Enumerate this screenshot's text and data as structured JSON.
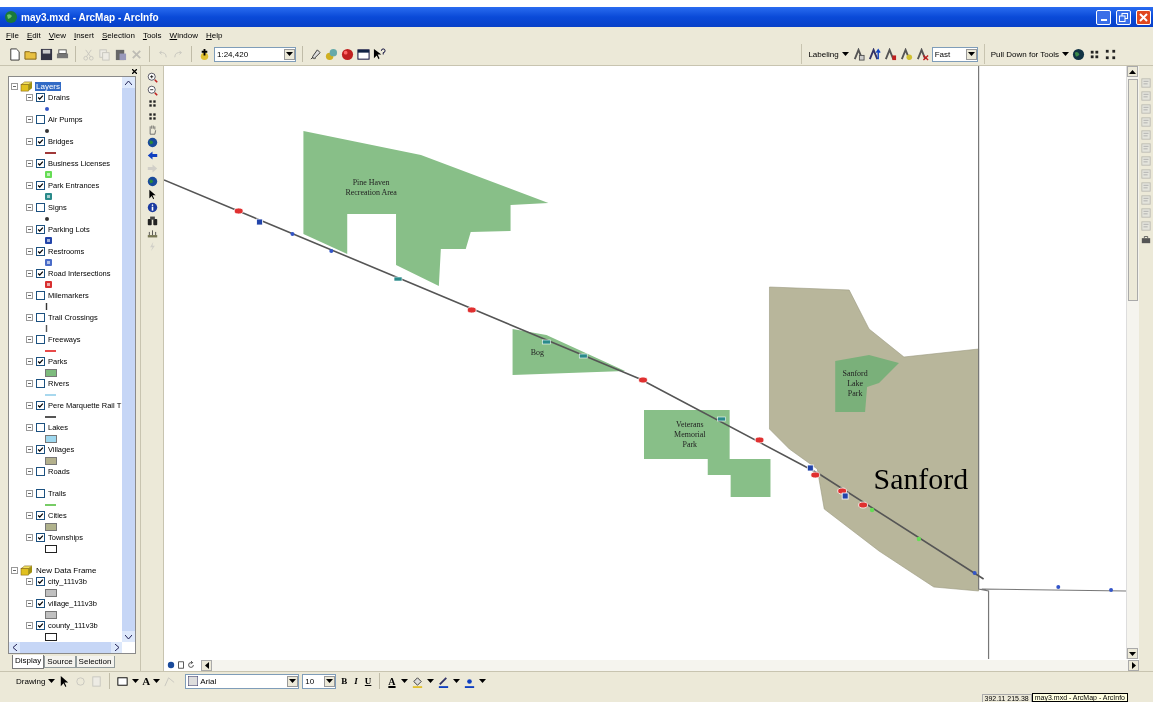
{
  "window": {
    "title": "may3.mxd - ArcMap - ArcInfo"
  },
  "menu": [
    "File",
    "Edit",
    "View",
    "Insert",
    "Selection",
    "Tools",
    "Window",
    "Help"
  ],
  "standard_toolbar": {
    "scale": "1:24,420"
  },
  "labeling_toolbar": {
    "label": "Labeling",
    "quality": "Fast"
  },
  "tools_toolbar": {
    "label": "Pull Down for Tools"
  },
  "toc": {
    "frames": [
      {
        "name": "Layers",
        "selected": true,
        "layers": [
          {
            "name": "Drains",
            "checked": true,
            "kind": "dot",
            "color": "#3355c8"
          },
          {
            "name": "Air Pumps",
            "checked": false,
            "kind": "dot",
            "color": "#333333"
          },
          {
            "name": "Bridges",
            "checked": true,
            "kind": "line",
            "color": "#a03838"
          },
          {
            "name": "Business Licenses",
            "checked": true,
            "kind": "mark",
            "color": "#66dd55"
          },
          {
            "name": "Park Entrances",
            "checked": true,
            "kind": "mark",
            "color": "#2a8a8a"
          },
          {
            "name": "Signs",
            "checked": false,
            "kind": "dot",
            "color": "#333333"
          },
          {
            "name": "Parking Lots",
            "checked": true,
            "kind": "mark",
            "color": "#2244aa"
          },
          {
            "name": "Restrooms",
            "checked": true,
            "kind": "mark",
            "color": "#4a6cc8"
          },
          {
            "name": "Road Intersections",
            "checked": true,
            "kind": "mark",
            "color": "#d83030"
          },
          {
            "name": "Milemarkers",
            "checked": false,
            "kind": "tick",
            "color": "#333333"
          },
          {
            "name": "Trail Crossings",
            "checked": false,
            "kind": "tick",
            "color": "#555555"
          },
          {
            "name": "Freeways",
            "checked": false,
            "kind": "line",
            "color": "#e84a4a"
          },
          {
            "name": "Parks",
            "checked": true,
            "kind": "fill",
            "color": "#7dbb7d"
          },
          {
            "name": "Rivers",
            "checked": false,
            "kind": "line",
            "color": "#a8d8ee"
          },
          {
            "name": "Pere Marquette Rail T",
            "checked": true,
            "kind": "line",
            "color": "#555555"
          },
          {
            "name": "Lakes",
            "checked": false,
            "kind": "fill",
            "color": "#9ed8ef"
          },
          {
            "name": "Villages",
            "checked": true,
            "kind": "fill",
            "color": "#b3b08c"
          },
          {
            "name": "Roads",
            "checked": false,
            "kind": "none"
          },
          {
            "name": "Trails",
            "checked": false,
            "kind": "line",
            "color": "#77cc66"
          },
          {
            "name": "Cities",
            "checked": true,
            "kind": "fill",
            "color": "#b0b28c"
          },
          {
            "name": "Townships",
            "checked": true,
            "kind": "outline"
          }
        ]
      },
      {
        "name": "New Data Frame",
        "selected": false,
        "layers": [
          {
            "name": "city_111v3b",
            "checked": true,
            "kind": "fill",
            "color": "#c0c0c0"
          },
          {
            "name": "village_111v3b",
            "checked": true,
            "kind": "fill",
            "color": "#c0c0c0"
          },
          {
            "name": "county_111v3b",
            "checked": true,
            "kind": "outline"
          }
        ]
      }
    ],
    "tabs": [
      {
        "label": "Display",
        "selected": true
      },
      {
        "label": "Source",
        "selected": false
      },
      {
        "label": "Selection",
        "selected": false
      }
    ]
  },
  "map": {
    "labels": [
      {
        "text": "Pine Haven Recreation Area",
        "kind": "park"
      },
      {
        "text": "Bog",
        "kind": "park"
      },
      {
        "text": "Veterans Memorial Park",
        "kind": "park"
      },
      {
        "text": "Sanford Lake Park",
        "kind": "park"
      },
      {
        "text": "Sanford",
        "kind": "village"
      }
    ]
  },
  "drawing_toolbar": {
    "label": "Drawing",
    "new_text": "A",
    "font": "Arial",
    "size": "10",
    "bold": "B",
    "italic": "I",
    "underline": "U",
    "font_color": "A"
  },
  "status_bar": {
    "coordinates": "392.11  215.38",
    "tooltip": "may3.mxd - ArcMap - ArcInfo"
  }
}
